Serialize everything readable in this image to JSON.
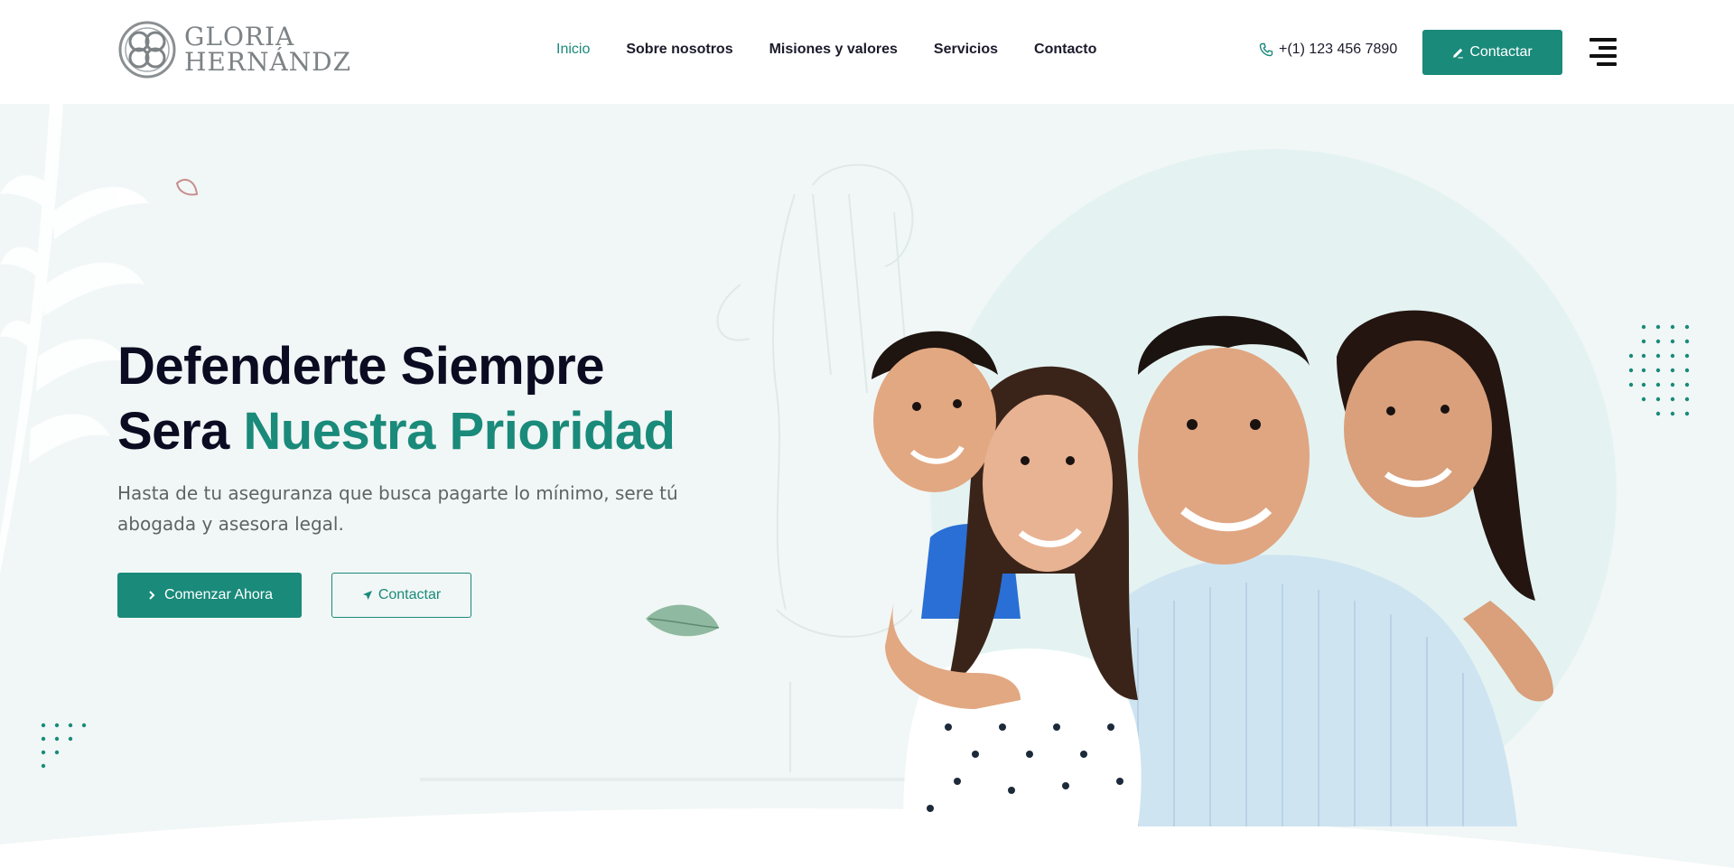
{
  "header": {
    "logo": {
      "line1": "GLORIA",
      "line2": "HERNÁNDZ"
    },
    "nav": [
      {
        "label": "Inicio",
        "active": true
      },
      {
        "label": "Sobre nosotros",
        "active": false
      },
      {
        "label": "Misiones y valores",
        "active": false
      },
      {
        "label": "Servicios",
        "active": false
      },
      {
        "label": "Contacto",
        "active": false
      }
    ],
    "phone": "+(1) 123 456 7890",
    "cta_label": "Contactar"
  },
  "hero": {
    "title_line1": "Defenderte Siempre",
    "title_line2_plain": "Sera ",
    "title_line2_accent": "Nuestra Prioridad",
    "subtitle": "Hasta de tu aseguranza que busca pagarte lo mínimo, sere tú abogada y asesora legal.",
    "primary_button": "Comenzar Ahora",
    "secondary_button": "Contactar"
  },
  "icons": {
    "phone": "phone-icon",
    "edit": "pencil-icon",
    "menu": "hamburger-icon",
    "chevron": "chevron-right-icon",
    "send": "paper-plane-icon"
  },
  "colors": {
    "accent": "#1a8a7a",
    "hero_bg": "#f1f7f6",
    "heading": "#0b0b22",
    "body_text": "#5e6366"
  }
}
